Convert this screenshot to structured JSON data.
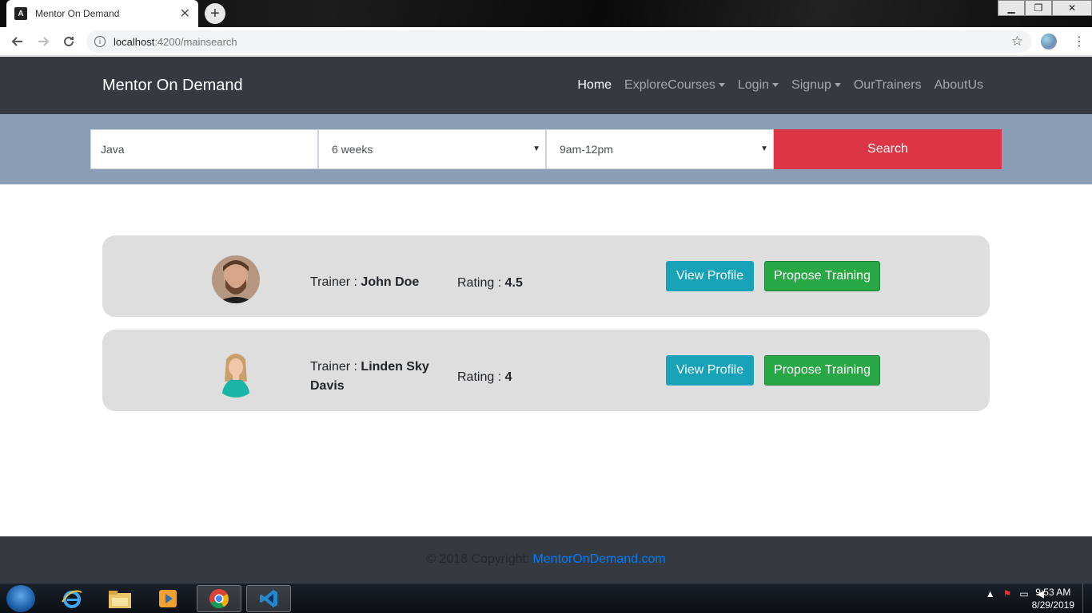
{
  "browser": {
    "tab_title": "Mentor On Demand",
    "tab_favicon": "A",
    "close_glyph": "✕",
    "newtab_glyph": "+",
    "url_host": "localhost",
    "url_path": ":4200/mainsearch",
    "win_min": "▁",
    "win_max": "❐",
    "win_close": "✕"
  },
  "navbar": {
    "brand": "Mentor On Demand",
    "links": [
      {
        "label": "Home",
        "active": true
      },
      {
        "label": "ExploreCourses",
        "dropdown": true
      },
      {
        "label": "Login",
        "dropdown": true
      },
      {
        "label": "Signup",
        "dropdown": true
      },
      {
        "label": "OurTrainers"
      },
      {
        "label": "AboutUs"
      }
    ]
  },
  "search": {
    "technology_value": "Java",
    "duration_value": "6 weeks",
    "timeslot_value": "9am-12pm",
    "button_label": "Search"
  },
  "results": [
    {
      "trainer_label": "Trainer : ",
      "trainer_name": "John Doe",
      "rating_label": "Rating : ",
      "rating_value": "4.5",
      "view_label": "View Profile",
      "propose_label": "Propose Training"
    },
    {
      "trainer_label": "Trainer : ",
      "trainer_name": "Linden Sky Davis",
      "rating_label": "Rating : ",
      "rating_value": "4",
      "view_label": "View Profile",
      "propose_label": "Propose Training"
    }
  ],
  "footer": {
    "copyright": "© 2018 Copyright:",
    "link": "MentorOnDemand.com"
  },
  "taskbar": {
    "time": "9:53 AM",
    "date": "8/29/2019"
  },
  "colors": {
    "navbar_bg": "#343a40",
    "searchbar_bg": "#8a9fb5",
    "search_button": "#dc3545",
    "view_button": "#17a2b8",
    "propose_button": "#28a745",
    "footer_link": "#007bff"
  }
}
